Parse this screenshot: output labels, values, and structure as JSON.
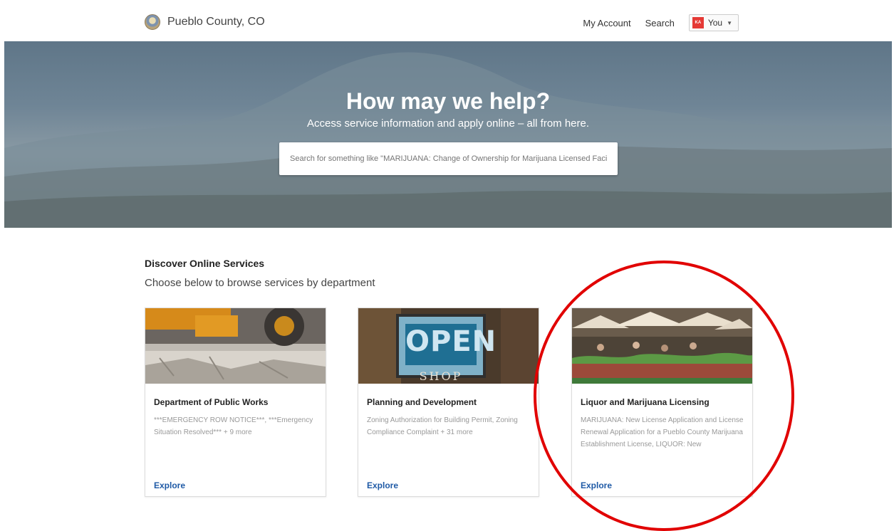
{
  "header": {
    "brand": "Pueblo County, CO",
    "nav_account": "My Account",
    "nav_search": "Search",
    "user_initials": "KA",
    "user_label": "You"
  },
  "hero": {
    "title": "How may we help?",
    "subtitle": "Access service information and apply online – all from here.",
    "search_placeholder": "Search for something like \"MARIJUANA: Change of Ownership for Marijuana Licensed Facili..."
  },
  "discover": {
    "title": "Discover Online Services",
    "subtitle": "Choose below to browse services by department"
  },
  "cards": [
    {
      "title": "Department of Public Works",
      "desc": "***EMERGENCY ROW NOTICE***, ***Emergency Situation Resolved*** + 9 more",
      "explore": "Explore"
    },
    {
      "title": "Planning and Development",
      "desc": "Zoning Authorization for Building Permit, Zoning Compliance Complaint + 31 more",
      "explore": "Explore",
      "sign_main": "OPEN",
      "sign_sub": "SHOP"
    },
    {
      "title": "Liquor and Marijuana Licensing",
      "desc": "MARIJUANA: New License Application and License Renewal Application for a Pueblo County Marijuana Establishment License, LIQUOR: New",
      "explore": "Explore"
    }
  ],
  "colors": {
    "accent": "#1f5aa6",
    "annotation": "#e10000"
  }
}
